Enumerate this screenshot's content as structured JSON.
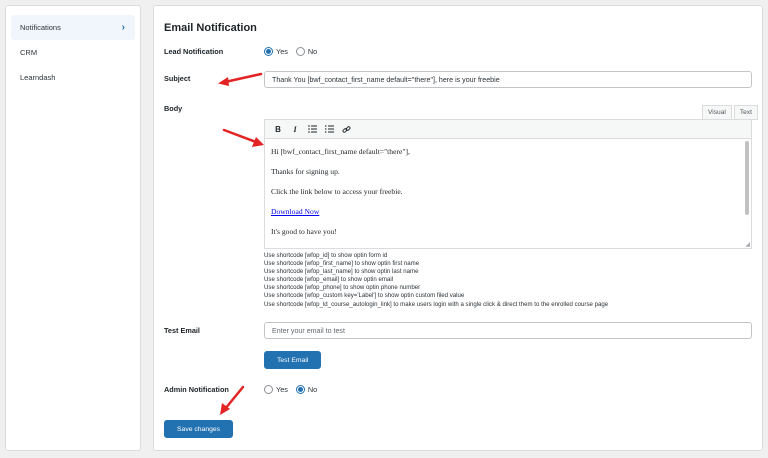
{
  "sidebar": {
    "items": [
      {
        "label": "Notifications",
        "active": true
      },
      {
        "label": "CRM",
        "active": false
      },
      {
        "label": "Learndash",
        "active": false
      }
    ],
    "chevron_icon": "chevron-right-icon"
  },
  "panel": {
    "title": "Email Notification",
    "lead_notification": {
      "label": "Lead Notification",
      "options": [
        "Yes",
        "No"
      ],
      "selected": "Yes"
    },
    "subject": {
      "label": "Subject",
      "value": "Thank You [bwf_contact_first_name default=\"there\"], here is your freebie"
    },
    "body": {
      "label": "Body",
      "tabs": [
        "Visual",
        "Text"
      ],
      "active_tab": "Visual",
      "toolbar": [
        "bold-icon",
        "italic-icon",
        "bulleted-list-icon",
        "numbered-list-icon",
        "link-icon"
      ],
      "lines": [
        "Hi [bwf_contact_first_name default=\"there\"],",
        "Thanks for signing up.",
        "Click the link below to access your freebie.",
        "Download Now",
        "It's good to have you!"
      ]
    },
    "hints": [
      "Use shortcode [wfop_id] to show optin form id",
      "Use shortcode [wfop_first_name] to show optin first name",
      "Use shortcode [wfop_last_name] to show optin last name",
      "Use shortcode [wfop_email] to show optin email",
      "Use shortcode [wfop_phone] to show optin phone number",
      "Use shortcode [wfop_custom key='Label'] to show optin custom filed value",
      "Use shortcode [wfop_ld_course_autologin_link] to make users login with a single click & direct them to the enrolled course page"
    ],
    "test_email": {
      "label": "Test Email",
      "placeholder": "Enter your email to test",
      "button": "Test Email"
    },
    "admin_notification": {
      "label": "Admin Notification",
      "options": [
        "Yes",
        "No"
      ],
      "selected": "No"
    },
    "save_button": "Save changes"
  },
  "colors": {
    "accent": "#2271b1",
    "arrow": "#e22424"
  }
}
